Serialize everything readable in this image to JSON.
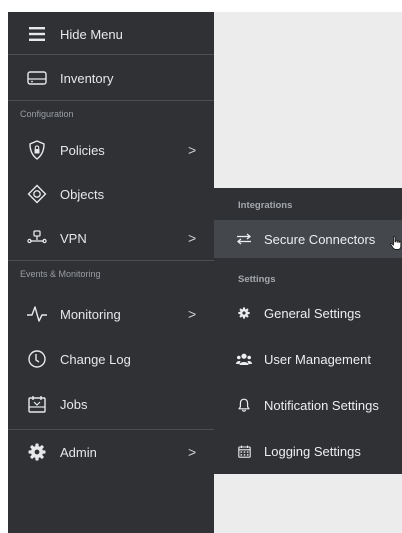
{
  "sidebar": {
    "hide_menu": "Hide Menu",
    "inventory": "Inventory",
    "section_configuration": "Configuration",
    "policies": "Policies",
    "objects": "Objects",
    "vpn": "VPN",
    "section_events": "Events & Monitoring",
    "monitoring": "Monitoring",
    "change_log": "Change Log",
    "jobs": "Jobs",
    "admin": "Admin",
    "chevron": ">"
  },
  "flyout": {
    "section_integrations": "Integrations",
    "secure_connectors": "Secure Connectors",
    "section_settings": "Settings",
    "general_settings": "General Settings",
    "user_management": "User Management",
    "notification_settings": "Notification Settings",
    "logging_settings": "Logging Settings"
  },
  "icons": {
    "hide_menu": "hamburger-icon",
    "inventory": "device-icon",
    "policies": "shield-lock-icon",
    "objects": "objects-icon",
    "vpn": "vpn-network-icon",
    "monitoring": "pulse-icon",
    "change_log": "clock-icon",
    "jobs": "calendar-jobs-icon",
    "admin": "gear-icon",
    "secure_connectors": "swap-arrows-icon",
    "general_settings": "gear-icon",
    "user_management": "users-icon",
    "notification_settings": "bell-icon",
    "logging_settings": "calendar-icon"
  },
  "colors": {
    "sidebar_bg": "#2f3134",
    "active_bg": "#44474b",
    "content_bg": "#ececec"
  }
}
